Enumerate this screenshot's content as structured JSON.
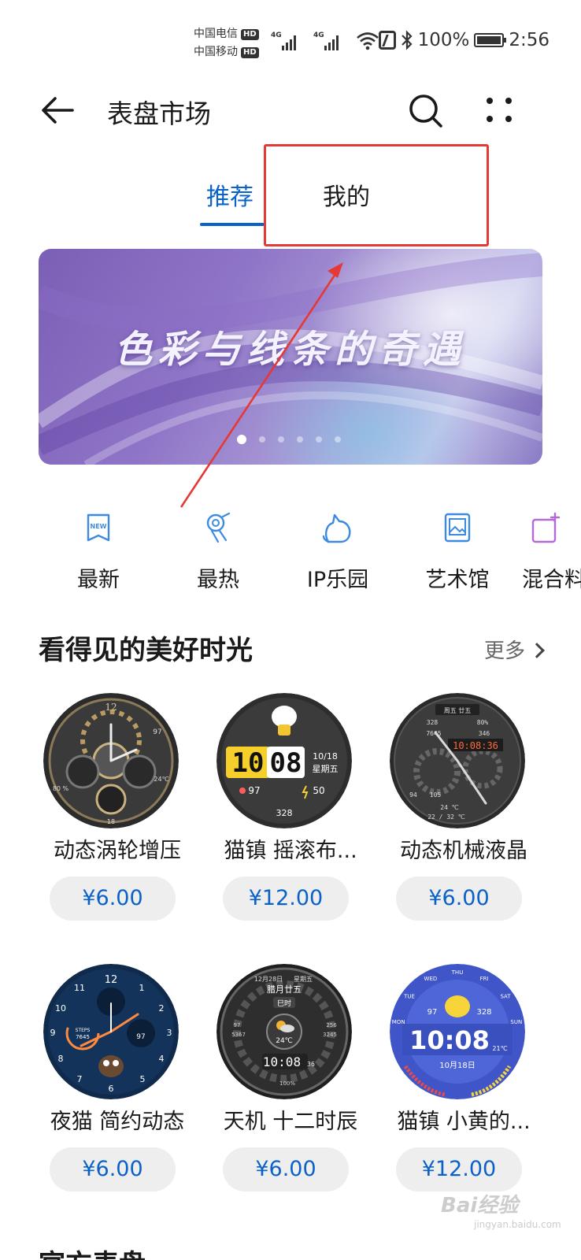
{
  "status_bar": {
    "carrier1": "中国电信",
    "carrier2": "中国移动",
    "hd_label": "HD",
    "net1": "4G",
    "net2": "4G",
    "battery": "100%",
    "time": "2:56"
  },
  "header": {
    "title": "表盘市场",
    "back_icon": "back-arrow-icon",
    "search_icon": "search-icon",
    "more_icon": "more-dots-icon"
  },
  "tabs": {
    "recommend": "推荐",
    "mine": "我的",
    "active_color": "#0a62c9"
  },
  "annotation": {
    "box_color": "#e53935"
  },
  "banner": {
    "text": "色彩与线条的奇遇",
    "slide_count": 6,
    "active_slide": 1
  },
  "categories": [
    {
      "label": "最新",
      "icon": "new-icon"
    },
    {
      "label": "最热",
      "icon": "hot-icon"
    },
    {
      "label": "IP乐园",
      "icon": "cat-icon"
    },
    {
      "label": "艺术馆",
      "icon": "picture-icon"
    },
    {
      "label": "混合料",
      "icon": "mix-icon"
    }
  ],
  "section": {
    "title": "看得见的美好时光",
    "more": "更多"
  },
  "watches": [
    {
      "name": "动态涡轮增压",
      "price": "¥6.00",
      "face": {
        "numbers": [
          "12",
          "97",
          "24℃",
          "80 %",
          "18"
        ]
      }
    },
    {
      "name": "猫镇 摇滚布...",
      "price": "¥12.00",
      "face": {
        "hour": "10",
        "minute": "08",
        "date": "10/18",
        "weekday": "星期五",
        "heart": "97",
        "power": "50",
        "steps": "328"
      }
    },
    {
      "name": "动态机械液晶",
      "price": "¥6.00",
      "face": {
        "date": "周五 廿五",
        "time": "10:08:36",
        "steps": "7645",
        "pct": "80%",
        "v1": "328",
        "v2": "346",
        "v3": "94",
        "v4": "105",
        "temp": "24 ℃",
        "range": "22 / 32 ℃"
      }
    },
    {
      "name": "夜猫 简约动态",
      "price": "¥6.00",
      "face": {
        "steps_label": "STEPS",
        "steps": "7645",
        "heart": "97",
        "n12": "12",
        "n1": "1",
        "n2": "2",
        "n3": "3",
        "n4": "4",
        "n5": "5",
        "n6": "6",
        "n7": "7",
        "n8": "8",
        "n9": "9",
        "n10": "10",
        "n11": "11"
      }
    },
    {
      "name": "天机 十二时辰",
      "price": "¥6.00",
      "face": {
        "date": "12月28日",
        "weekday": "星期五",
        "lunar": "腊月廿五",
        "shichen": "巳时",
        "temp": "24℃",
        "time": "10:08",
        "sec": "36",
        "pct": "100%",
        "v1": "97",
        "v2": "5367",
        "v3": "256",
        "v4": "3245"
      }
    },
    {
      "name": "猫镇 小黄的...",
      "price": "¥12.00",
      "face": {
        "time": "10:08",
        "date": "10月18日",
        "temp": "21℃",
        "heart": "97",
        "steps": "328",
        "days": [
          "MON",
          "TUE",
          "WED",
          "THU",
          "FRI",
          "SAT",
          "SUN"
        ]
      }
    }
  ],
  "next_section": {
    "title": "官方表盘"
  },
  "watermark": {
    "text": "Bai经验",
    "sub": "jingyan.baidu.com"
  }
}
